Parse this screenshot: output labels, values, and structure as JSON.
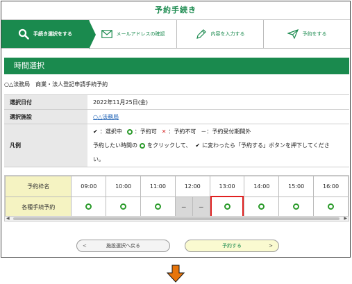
{
  "page_title": "予約手続き",
  "steps": [
    {
      "label": "手続き選択をする",
      "icon": "search-icon",
      "active": true
    },
    {
      "label": "メールアドレスの確認",
      "icon": "mail-icon",
      "active": false
    },
    {
      "label": "内容を入力する",
      "icon": "pencil-icon",
      "active": false
    },
    {
      "label": "予約をする",
      "icon": "paper-plane-icon",
      "active": false
    }
  ],
  "section_title": "時間選択",
  "facility_line": "○△法務局　商業・法人登記申請手続予約",
  "info": {
    "date_label": "選択日付",
    "date_value": "2022年11月25日(金)",
    "facility_label": "選択施設",
    "facility_value": "○△法務局",
    "legend_label": "凡例",
    "legend_selected": "：選択中",
    "legend_available": "：予約可",
    "legend_unavailable": "：予約不可",
    "legend_outside": "－：予約受付期間外",
    "instruction_1": "予約したい時間の",
    "instruction_2": "をクリックして、",
    "instruction_3": "に変わったら「予約する」ボタンを押下してくださ",
    "instruction_4": "い。"
  },
  "grid": {
    "header_label": "予約枠名",
    "row_label": "各種手続予約",
    "times": [
      "09:00",
      "10:00",
      "11:00",
      "12:00",
      "13:00",
      "14:00",
      "15:00",
      "16:00"
    ],
    "dash": "－"
  },
  "buttons": {
    "back": "施設選択へ戻る",
    "next": "予約する",
    "back_chevron": "<",
    "next_chevron": ">"
  },
  "scroll": {
    "left": "◀",
    "right": "▶"
  },
  "colors": {
    "brand_green": "#1a8a4e",
    "highlight_red": "#e02020",
    "arrow_orange": "#e8750a",
    "header_yellow": "#f5f3c2"
  }
}
